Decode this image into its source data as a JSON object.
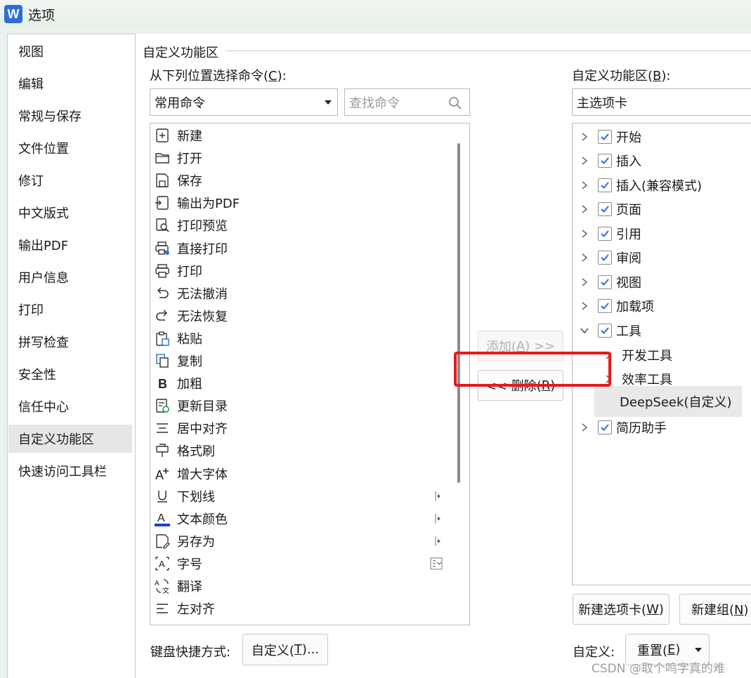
{
  "window": {
    "app_icon_letter": "W",
    "title": "选项"
  },
  "nav": {
    "items": [
      {
        "label": "视图"
      },
      {
        "label": "编辑"
      },
      {
        "label": "常规与保存"
      },
      {
        "label": "文件位置"
      },
      {
        "label": "修订"
      },
      {
        "label": "中文版式"
      },
      {
        "label": "输出PDF"
      },
      {
        "label": "用户信息"
      },
      {
        "label": "打印"
      },
      {
        "label": "拼写检查"
      },
      {
        "label": "安全性"
      },
      {
        "label": "信任中心"
      },
      {
        "label": "自定义功能区",
        "active": true
      },
      {
        "label": "快速访问工具栏"
      }
    ]
  },
  "group": {
    "title": "自定义功能区"
  },
  "left": {
    "label_prefix": "从下列位置选择命令(",
    "label_key": "C",
    "label_suffix": "):",
    "select_value": "常用命令",
    "search_placeholder": "查找命令",
    "commands": [
      {
        "label": "新建",
        "icon": "new-doc-icon"
      },
      {
        "label": "打开",
        "icon": "folder-icon"
      },
      {
        "label": "保存",
        "icon": "save-icon"
      },
      {
        "label": "输出为PDF",
        "icon": "pdf-export-icon"
      },
      {
        "label": "打印预览",
        "icon": "print-preview-icon"
      },
      {
        "label": "直接打印",
        "icon": "direct-print-icon"
      },
      {
        "label": "打印",
        "icon": "printer-icon"
      },
      {
        "label": "无法撤消",
        "icon": "undo-icon"
      },
      {
        "label": "无法恢复",
        "icon": "redo-icon"
      },
      {
        "label": "粘贴",
        "icon": "paste-icon"
      },
      {
        "label": "复制",
        "icon": "copy-icon"
      },
      {
        "label": "加粗",
        "icon": "bold-icon"
      },
      {
        "label": "更新目录",
        "icon": "update-toc-icon"
      },
      {
        "label": "居中对齐",
        "icon": "align-center-icon"
      },
      {
        "label": "格式刷",
        "icon": "format-painter-icon"
      },
      {
        "label": "增大字体",
        "icon": "font-increase-icon"
      },
      {
        "label": "下划线",
        "icon": "underline-icon",
        "sub": true
      },
      {
        "label": "文本颜色",
        "icon": "text-color-icon",
        "sub": true
      },
      {
        "label": "另存为",
        "icon": "save-as-icon",
        "sub": true
      },
      {
        "label": "字号",
        "icon": "font-size-icon",
        "sub_box": true
      },
      {
        "label": "翻译",
        "icon": "translate-icon"
      },
      {
        "label": "左对齐",
        "icon": "align-left-icon"
      }
    ],
    "shortcut_label": "键盘快捷方式:",
    "shortcut_button_prefix": "自定义(",
    "shortcut_button_key": "T",
    "shortcut_button_suffix": ")..."
  },
  "middle": {
    "add_prefix": "添加(",
    "add_key": "A",
    "add_suffix": ") >>",
    "remove_prefix": "<< 删除(",
    "remove_key": "R",
    "remove_suffix": ")"
  },
  "right": {
    "label_prefix": "自定义功能区(",
    "label_key": "B",
    "label_suffix": "):",
    "select_value": "主选项卡",
    "tree": [
      {
        "label": "开始",
        "checked": true,
        "expanded": false,
        "level": 0
      },
      {
        "label": "插入",
        "checked": true,
        "expanded": false,
        "level": 0
      },
      {
        "label": "插入(兼容模式)",
        "checked": true,
        "expanded": false,
        "level": 0
      },
      {
        "label": "页面",
        "checked": true,
        "expanded": false,
        "level": 0
      },
      {
        "label": "引用",
        "checked": true,
        "expanded": false,
        "level": 0
      },
      {
        "label": "审阅",
        "checked": true,
        "expanded": false,
        "level": 0
      },
      {
        "label": "视图",
        "checked": true,
        "expanded": false,
        "level": 0
      },
      {
        "label": "加载项",
        "checked": true,
        "expanded": false,
        "level": 0
      },
      {
        "label": "工具",
        "checked": true,
        "expanded": true,
        "level": 0
      },
      {
        "label": "开发工具",
        "level": 1
      },
      {
        "label": "效率工具",
        "level": 1
      },
      {
        "label": "DeepSeek(自定义)",
        "level": 2,
        "selected": true
      },
      {
        "label": "简历助手",
        "checked": true,
        "expanded": false,
        "level": 0
      }
    ],
    "new_tab_prefix": "新建选项卡(",
    "new_tab_key": "W",
    "new_tab_suffix": ")",
    "new_group_prefix": "新建组(",
    "new_group_key": "N",
    "new_group_suffix": ")",
    "custom_label": "自定义:",
    "reset_prefix": "重置(",
    "reset_key": "E",
    "reset_suffix": ")"
  },
  "accent_colors": {
    "highlight": "#e8191a",
    "app_icon": "#2d6ddb",
    "text_color_bar": "#1f3fd1"
  },
  "watermark": "CSDN @取个鸣字真的难"
}
